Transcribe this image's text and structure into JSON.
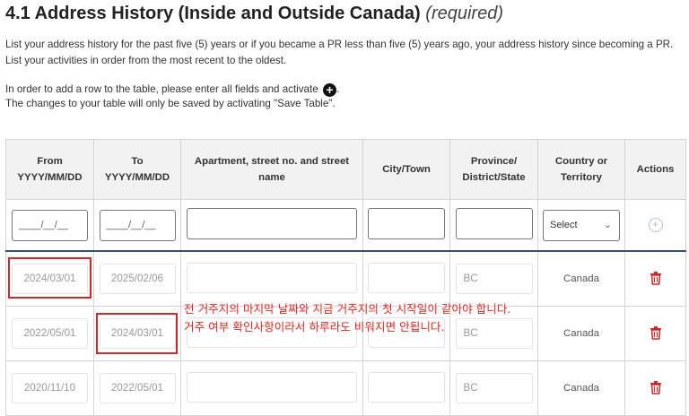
{
  "page": {
    "title": "4.1 Address History (Inside and Outside Canada)",
    "required_label": "(required)",
    "intro": "List your address history for the past five (5) years or if you became a PR less than five (5) years ago, your address history since becoming a PR. List your activities in order from the most recent to the oldest.",
    "instruction_line1": "In order to add a row to the table, please enter all fields and activate",
    "instruction_line1_end": ".",
    "instruction_line2": "The changes to your table will only be saved by activating \"Save Table\"."
  },
  "table": {
    "headers": {
      "from": "From",
      "from_format": "YYYY/MM/DD",
      "to": "To",
      "to_format": "YYYY/MM/DD",
      "address": "Apartment, street no. and street name",
      "city": "City/Town",
      "province": "Province/ District/State",
      "country": "Country or Territory",
      "actions": "Actions"
    },
    "entry_row": {
      "from_placeholder": "____/__/__",
      "to_placeholder": "____/__/__",
      "country_select": "Select"
    },
    "rows": [
      {
        "from": "2024/03/01",
        "to": "2025/02/06",
        "province": "BC",
        "country": "Canada"
      },
      {
        "from": "2022/05/01",
        "to": "2024/03/01",
        "province": "BC",
        "country": "Canada"
      },
      {
        "from": "2020/11/10",
        "to": "2022/05/01",
        "province": "BC",
        "country": "Canada"
      }
    ]
  },
  "annotation": {
    "line1": "전 거주지의 마지막 날짜와 지금 거주지의 첫 시작일이 같아야 합니다.",
    "line2": "거주 여부 확인사항이라서 하루라도 비워지면 안됩니다.",
    "color": "#d0272a"
  },
  "icons": {
    "add_row": "plus-circle-icon",
    "delete_row": "trash-icon",
    "select_arrow": "chevron-down-icon"
  }
}
